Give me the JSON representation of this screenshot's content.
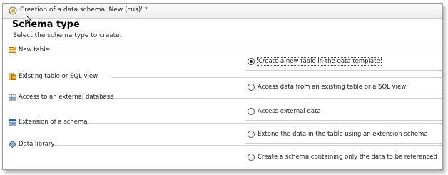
{
  "window": {
    "title": "Creation of a data schema 'New (cus)' *",
    "title_icon": "schema-icon"
  },
  "page": {
    "heading": "Schema type",
    "subheading": "Select the schema type to create."
  },
  "sections": [
    {
      "label": "New table",
      "icon": "new-table-icon",
      "option": "Create a new table in the data template",
      "selected": true
    },
    {
      "label": "Existing table or SQL view",
      "icon": "existing-table-icon",
      "option": "Access data from an existing table or a SQL view",
      "selected": false
    },
    {
      "label": "Access to an external database",
      "icon": "external-database-icon",
      "option": "Access external data",
      "selected": false
    },
    {
      "label": "Extension of a schema",
      "icon": "schema-extension-icon",
      "option": "Extend the data in the table using an extension schema",
      "selected": false
    },
    {
      "label": "Data library",
      "icon": "data-library-icon",
      "option": "Create a schema containing only the data to be referenced",
      "selected": false
    }
  ]
}
